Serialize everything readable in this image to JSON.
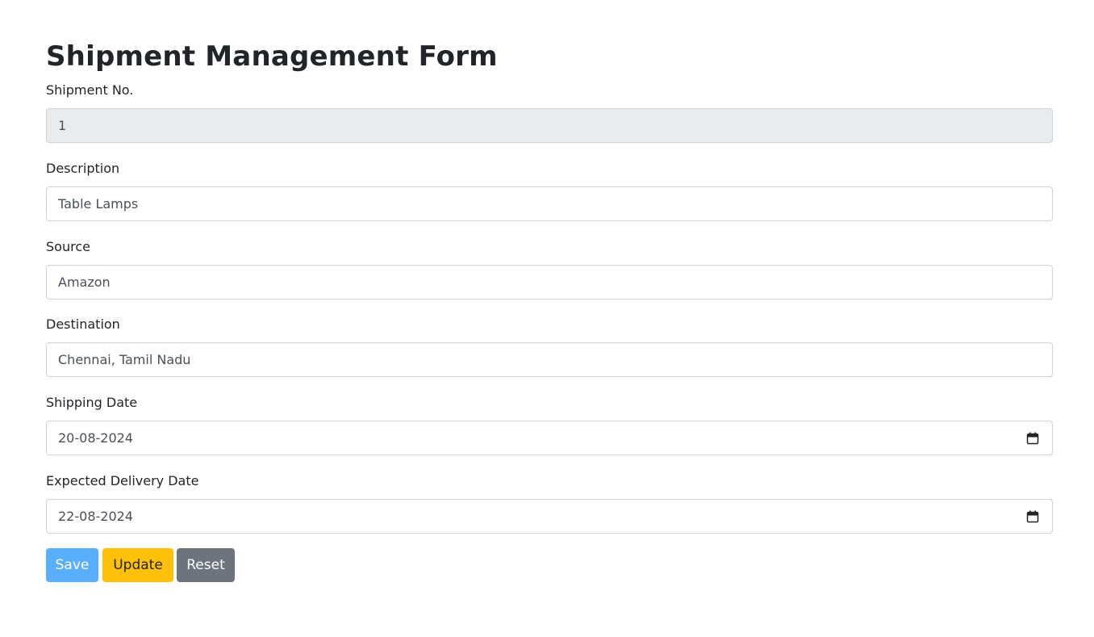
{
  "page": {
    "title": "Shipment Management Form"
  },
  "form": {
    "shipment_no": {
      "label": "Shipment No.",
      "value": "1"
    },
    "description": {
      "label": "Description",
      "value": "Table Lamps"
    },
    "source": {
      "label": "Source",
      "value": "Amazon"
    },
    "destination": {
      "label": "Destination",
      "value": "Chennai, Tamil Nadu"
    },
    "shipping_date": {
      "label": "Shipping Date",
      "value": "20-08-2024"
    },
    "expected_delivery_date": {
      "label": "Expected Delivery Date",
      "value": "22-08-2024"
    }
  },
  "buttons": {
    "save": "Save",
    "update": "Update",
    "reset": "Reset"
  },
  "colors": {
    "save": "#5aaefe",
    "update": "#ffc107",
    "reset": "#6c757d",
    "readonly_bg": "#e9ecef"
  },
  "icons": {
    "date": "calendar-icon"
  }
}
